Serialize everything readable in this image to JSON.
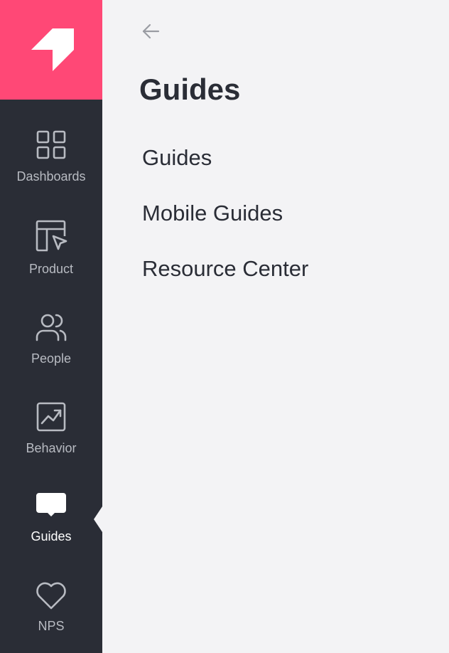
{
  "sidebar": {
    "logo_icon": "pendo-logo-icon",
    "items": [
      {
        "label": "Dashboards",
        "icon": "grid-icon"
      },
      {
        "label": "Product",
        "icon": "layout-cursor-icon"
      },
      {
        "label": "People",
        "icon": "people-icon"
      },
      {
        "label": "Behavior",
        "icon": "trend-chart-icon"
      },
      {
        "label": "Guides",
        "icon": "speech-bubble-icon",
        "active": true
      },
      {
        "label": "NPS",
        "icon": "heart-icon"
      }
    ]
  },
  "panel": {
    "back_icon": "arrow-left-icon",
    "title": "Guides",
    "items": [
      {
        "label": "Guides"
      },
      {
        "label": "Mobile Guides"
      },
      {
        "label": "Resource Center"
      }
    ]
  },
  "colors": {
    "brand": "#ff4876",
    "rail_bg": "#2a2d36",
    "panel_bg": "#f3f3f5",
    "text_dark": "#2a2d36",
    "rail_text": "#b8bbc2",
    "rail_text_active": "#ffffff"
  }
}
